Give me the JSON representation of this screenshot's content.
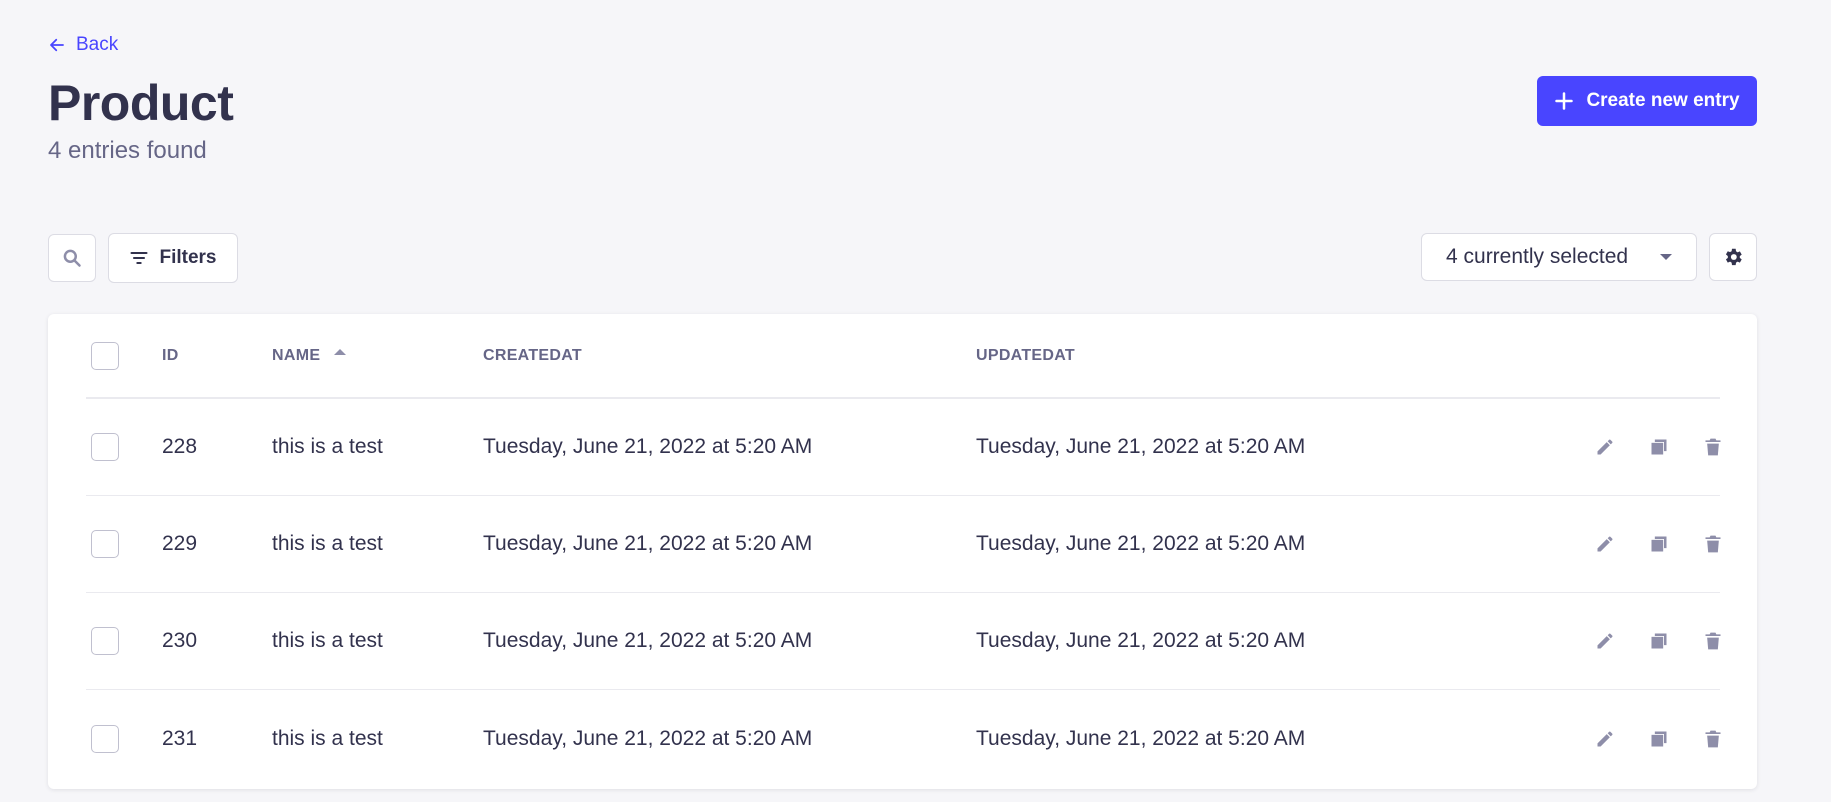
{
  "header": {
    "back_label": "Back",
    "title": "Product",
    "subtitle": "4 entries found",
    "create_label": "Create new entry"
  },
  "toolbar": {
    "filters_label": "Filters",
    "columns_select_value": "4 currently selected"
  },
  "table": {
    "columns": [
      "ID",
      "NAME",
      "CREATEDAT",
      "UPDATEDAT"
    ],
    "sorted_column": "NAME",
    "sort_direction": "asc",
    "rows": [
      {
        "id": "228",
        "name": "this is a test",
        "createdAt": "Tuesday, June 21, 2022 at 5:20 AM",
        "updatedAt": "Tuesday, June 21, 2022 at 5:20 AM"
      },
      {
        "id": "229",
        "name": "this is a test",
        "createdAt": "Tuesday, June 21, 2022 at 5:20 AM",
        "updatedAt": "Tuesday, June 21, 2022 at 5:20 AM"
      },
      {
        "id": "230",
        "name": "this is a test",
        "createdAt": "Tuesday, June 21, 2022 at 5:20 AM",
        "updatedAt": "Tuesday, June 21, 2022 at 5:20 AM"
      },
      {
        "id": "231",
        "name": "this is a test",
        "createdAt": "Tuesday, June 21, 2022 at 5:20 AM",
        "updatedAt": "Tuesday, June 21, 2022 at 5:20 AM"
      }
    ],
    "row_action_icons": [
      "pencil-icon",
      "duplicate-icon",
      "trash-icon"
    ]
  },
  "colors": {
    "primary": "#4945ff",
    "background": "#f6f6f9",
    "text": "#32324d",
    "muted": "#666687",
    "icon": "#8e8ea9"
  }
}
